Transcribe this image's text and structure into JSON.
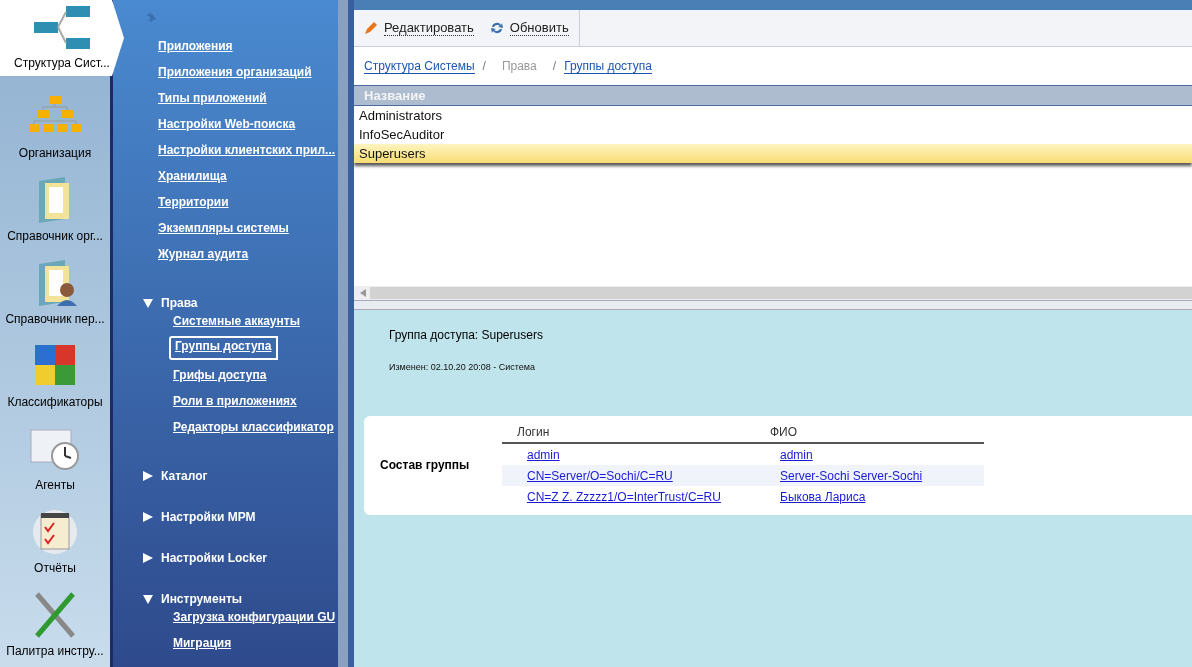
{
  "app_bar": [
    {
      "label": "Структура Сист...",
      "selected": true
    },
    {
      "label": "Организация",
      "selected": false
    },
    {
      "label": "Справочник орг...",
      "selected": false
    },
    {
      "label": "Справочник пер...",
      "selected": false
    },
    {
      "label": "Классификаторы",
      "selected": false
    },
    {
      "label": "Агенты",
      "selected": false
    },
    {
      "label": "Отчёты",
      "selected": false
    },
    {
      "label": "Палитра инстру...",
      "selected": false
    }
  ],
  "nav": {
    "links": [
      {
        "label": "Приложения",
        "selected": false
      },
      {
        "label": "Приложения организаций",
        "selected": false
      },
      {
        "label": "Типы приложений",
        "selected": false
      },
      {
        "label": "Настройки Web-поиска",
        "selected": false
      },
      {
        "label": "Настройки клиентских прил...",
        "selected": false
      },
      {
        "label": "Хранилища",
        "selected": false
      },
      {
        "label": "Территории",
        "selected": false
      },
      {
        "label": "Экземпляры системы",
        "selected": false
      },
      {
        "label": "Журнал аудита",
        "selected": false
      }
    ],
    "sections": [
      {
        "title": "Права",
        "expanded": true,
        "items": [
          {
            "label": "Системные аккаунты",
            "selected": false
          },
          {
            "label": "Группы доступа",
            "selected": true
          },
          {
            "label": "Грифы доступа",
            "selected": false
          },
          {
            "label": "Роли в приложениях",
            "selected": false
          },
          {
            "label": "Редакторы классификатор",
            "selected": false
          }
        ]
      },
      {
        "title": "Каталог",
        "expanded": false
      },
      {
        "title": "Настройки МРМ",
        "expanded": false
      },
      {
        "title": "Настройки Locker",
        "expanded": false
      },
      {
        "title": "Инструменты",
        "expanded": true,
        "items": [
          {
            "label": "Загрузка конфигурации GU",
            "selected": false
          },
          {
            "label": "Миграция",
            "selected": false
          }
        ]
      }
    ]
  },
  "toolbar": [
    {
      "label": "Редактировать",
      "kind": "edit"
    },
    {
      "label": "Обновить",
      "kind": "refresh"
    }
  ],
  "breadcrumb": [
    {
      "label": "Структура Системы",
      "kind": "link"
    },
    {
      "label": "/",
      "kind": "separator"
    },
    {
      "label": "Права",
      "kind": "text"
    },
    {
      "label": "/",
      "kind": "separator"
    },
    {
      "label": "Группы доступа",
      "kind": "link"
    }
  ],
  "table": {
    "columns": [
      "Название"
    ],
    "rows": [
      {
        "name": "Administrators",
        "selected": false
      },
      {
        "name": "InfoSecAuditor",
        "selected": false
      },
      {
        "name": "Superusers",
        "selected": true
      }
    ]
  },
  "detail": {
    "title": "Группа доступа: Superusers",
    "modified": "Изменен: 02.10.20 20:08 - Система",
    "members": {
      "label": "Состав группы",
      "columns": [
        "Логин",
        "ФИО"
      ],
      "rows": [
        {
          "login": "admin",
          "name": "admin"
        },
        {
          "login": "CN=Server/O=Sochi/C=RU",
          "name": "Server-Sochi Server-Sochi"
        },
        {
          "login": "CN=Z Z. Zzzzz1/O=InterTrust/C=RU",
          "name": "Быкова Лариса"
        }
      ]
    }
  }
}
